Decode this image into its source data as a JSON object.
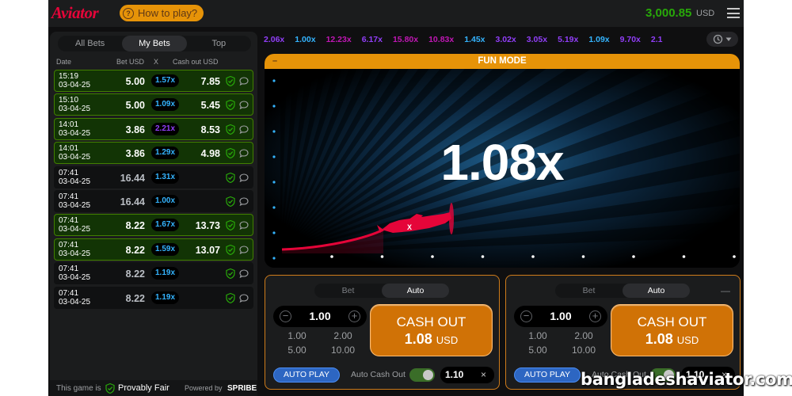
{
  "header": {
    "logo": "Aviator",
    "how_to_play": "How to play?",
    "balance": "3,000.85",
    "currency": "USD"
  },
  "left_panel": {
    "tabs": [
      "All Bets",
      "My Bets",
      "Top"
    ],
    "active_tab": "My Bets",
    "columns": {
      "date": "Date",
      "bet": "Bet USD",
      "x": "X",
      "cashout": "Cash out USD"
    },
    "rows": [
      {
        "time": "15:19",
        "date": "03-04-25",
        "bet": "5.00",
        "mult": "1.57x",
        "mult_color": "#34b4ff",
        "cashout": "7.85",
        "win": true
      },
      {
        "time": "15:10",
        "date": "03-04-25",
        "bet": "5.00",
        "mult": "1.09x",
        "mult_color": "#34b4ff",
        "cashout": "5.45",
        "win": true
      },
      {
        "time": "14:01",
        "date": "03-04-25",
        "bet": "3.86",
        "mult": "2.21x",
        "mult_color": "#913ef8",
        "cashout": "8.53",
        "win": true
      },
      {
        "time": "14:01",
        "date": "03-04-25",
        "bet": "3.86",
        "mult": "1.29x",
        "mult_color": "#34b4ff",
        "cashout": "4.98",
        "win": true
      },
      {
        "time": "07:41",
        "date": "03-04-25",
        "bet": "16.44",
        "mult": "1.31x",
        "mult_color": "#34b4ff",
        "cashout": "",
        "win": false
      },
      {
        "time": "07:41",
        "date": "03-04-25",
        "bet": "16.44",
        "mult": "1.00x",
        "mult_color": "#34b4ff",
        "cashout": "",
        "win": false
      },
      {
        "time": "07:41",
        "date": "03-04-25",
        "bet": "8.22",
        "mult": "1.67x",
        "mult_color": "#34b4ff",
        "cashout": "13.73",
        "win": true
      },
      {
        "time": "07:41",
        "date": "03-04-25",
        "bet": "8.22",
        "mult": "1.59x",
        "mult_color": "#34b4ff",
        "cashout": "13.07",
        "win": true
      },
      {
        "time": "07:41",
        "date": "03-04-25",
        "bet": "8.22",
        "mult": "1.19x",
        "mult_color": "#34b4ff",
        "cashout": "",
        "win": false
      },
      {
        "time": "07:41",
        "date": "03-04-25",
        "bet": "8.22",
        "mult": "1.19x",
        "mult_color": "#34b4ff",
        "cashout": "",
        "win": false
      }
    ],
    "footer": {
      "label": "This game is",
      "provably_fair": "Provably Fair",
      "powered_by": "Powered by",
      "brand": "SPRIBE"
    }
  },
  "history": [
    {
      "value": "2.06x",
      "color": "#913ef8"
    },
    {
      "value": "1.00x",
      "color": "#34b4ff"
    },
    {
      "value": "12.23x",
      "color": "#c017b4"
    },
    {
      "value": "6.17x",
      "color": "#913ef8"
    },
    {
      "value": "15.80x",
      "color": "#c017b4"
    },
    {
      "value": "10.83x",
      "color": "#c017b4"
    },
    {
      "value": "1.45x",
      "color": "#34b4ff"
    },
    {
      "value": "3.02x",
      "color": "#913ef8"
    },
    {
      "value": "3.05x",
      "color": "#913ef8"
    },
    {
      "value": "5.19x",
      "color": "#913ef8"
    },
    {
      "value": "1.09x",
      "color": "#34b4ff"
    },
    {
      "value": "9.70x",
      "color": "#913ef8"
    },
    {
      "value": "2.1",
      "color": "#913ef8"
    }
  ],
  "game": {
    "banner": "FUN MODE",
    "banner_dash": "–",
    "multiplier": "1.08x"
  },
  "panels": [
    {
      "tabs": [
        "Bet",
        "Auto"
      ],
      "active_tab": "Auto",
      "amount": "1.00",
      "quick": [
        "1.00",
        "2.00",
        "5.00",
        "10.00"
      ],
      "cashout_label": "CASH OUT",
      "cashout_value": "1.08",
      "cashout_currency": "USD",
      "autoplay": "AUTO PLAY",
      "auto_cashout_label": "Auto Cash Out",
      "auto_cashout_value": "1.10",
      "clear": "×",
      "menu": ""
    },
    {
      "tabs": [
        "Bet",
        "Auto"
      ],
      "active_tab": "Auto",
      "amount": "1.00",
      "quick": [
        "1.00",
        "2.00",
        "5.00",
        "10.00"
      ],
      "cashout_label": "CASH OUT",
      "cashout_value": "1.08",
      "cashout_currency": "USD",
      "autoplay": "AUTO PLAY",
      "auto_cashout_label": "Auto Cash Out",
      "auto_cashout_value": "1.10",
      "clear": "×",
      "menu": "—"
    }
  ],
  "watermark": "bangladeshaviator.com"
}
